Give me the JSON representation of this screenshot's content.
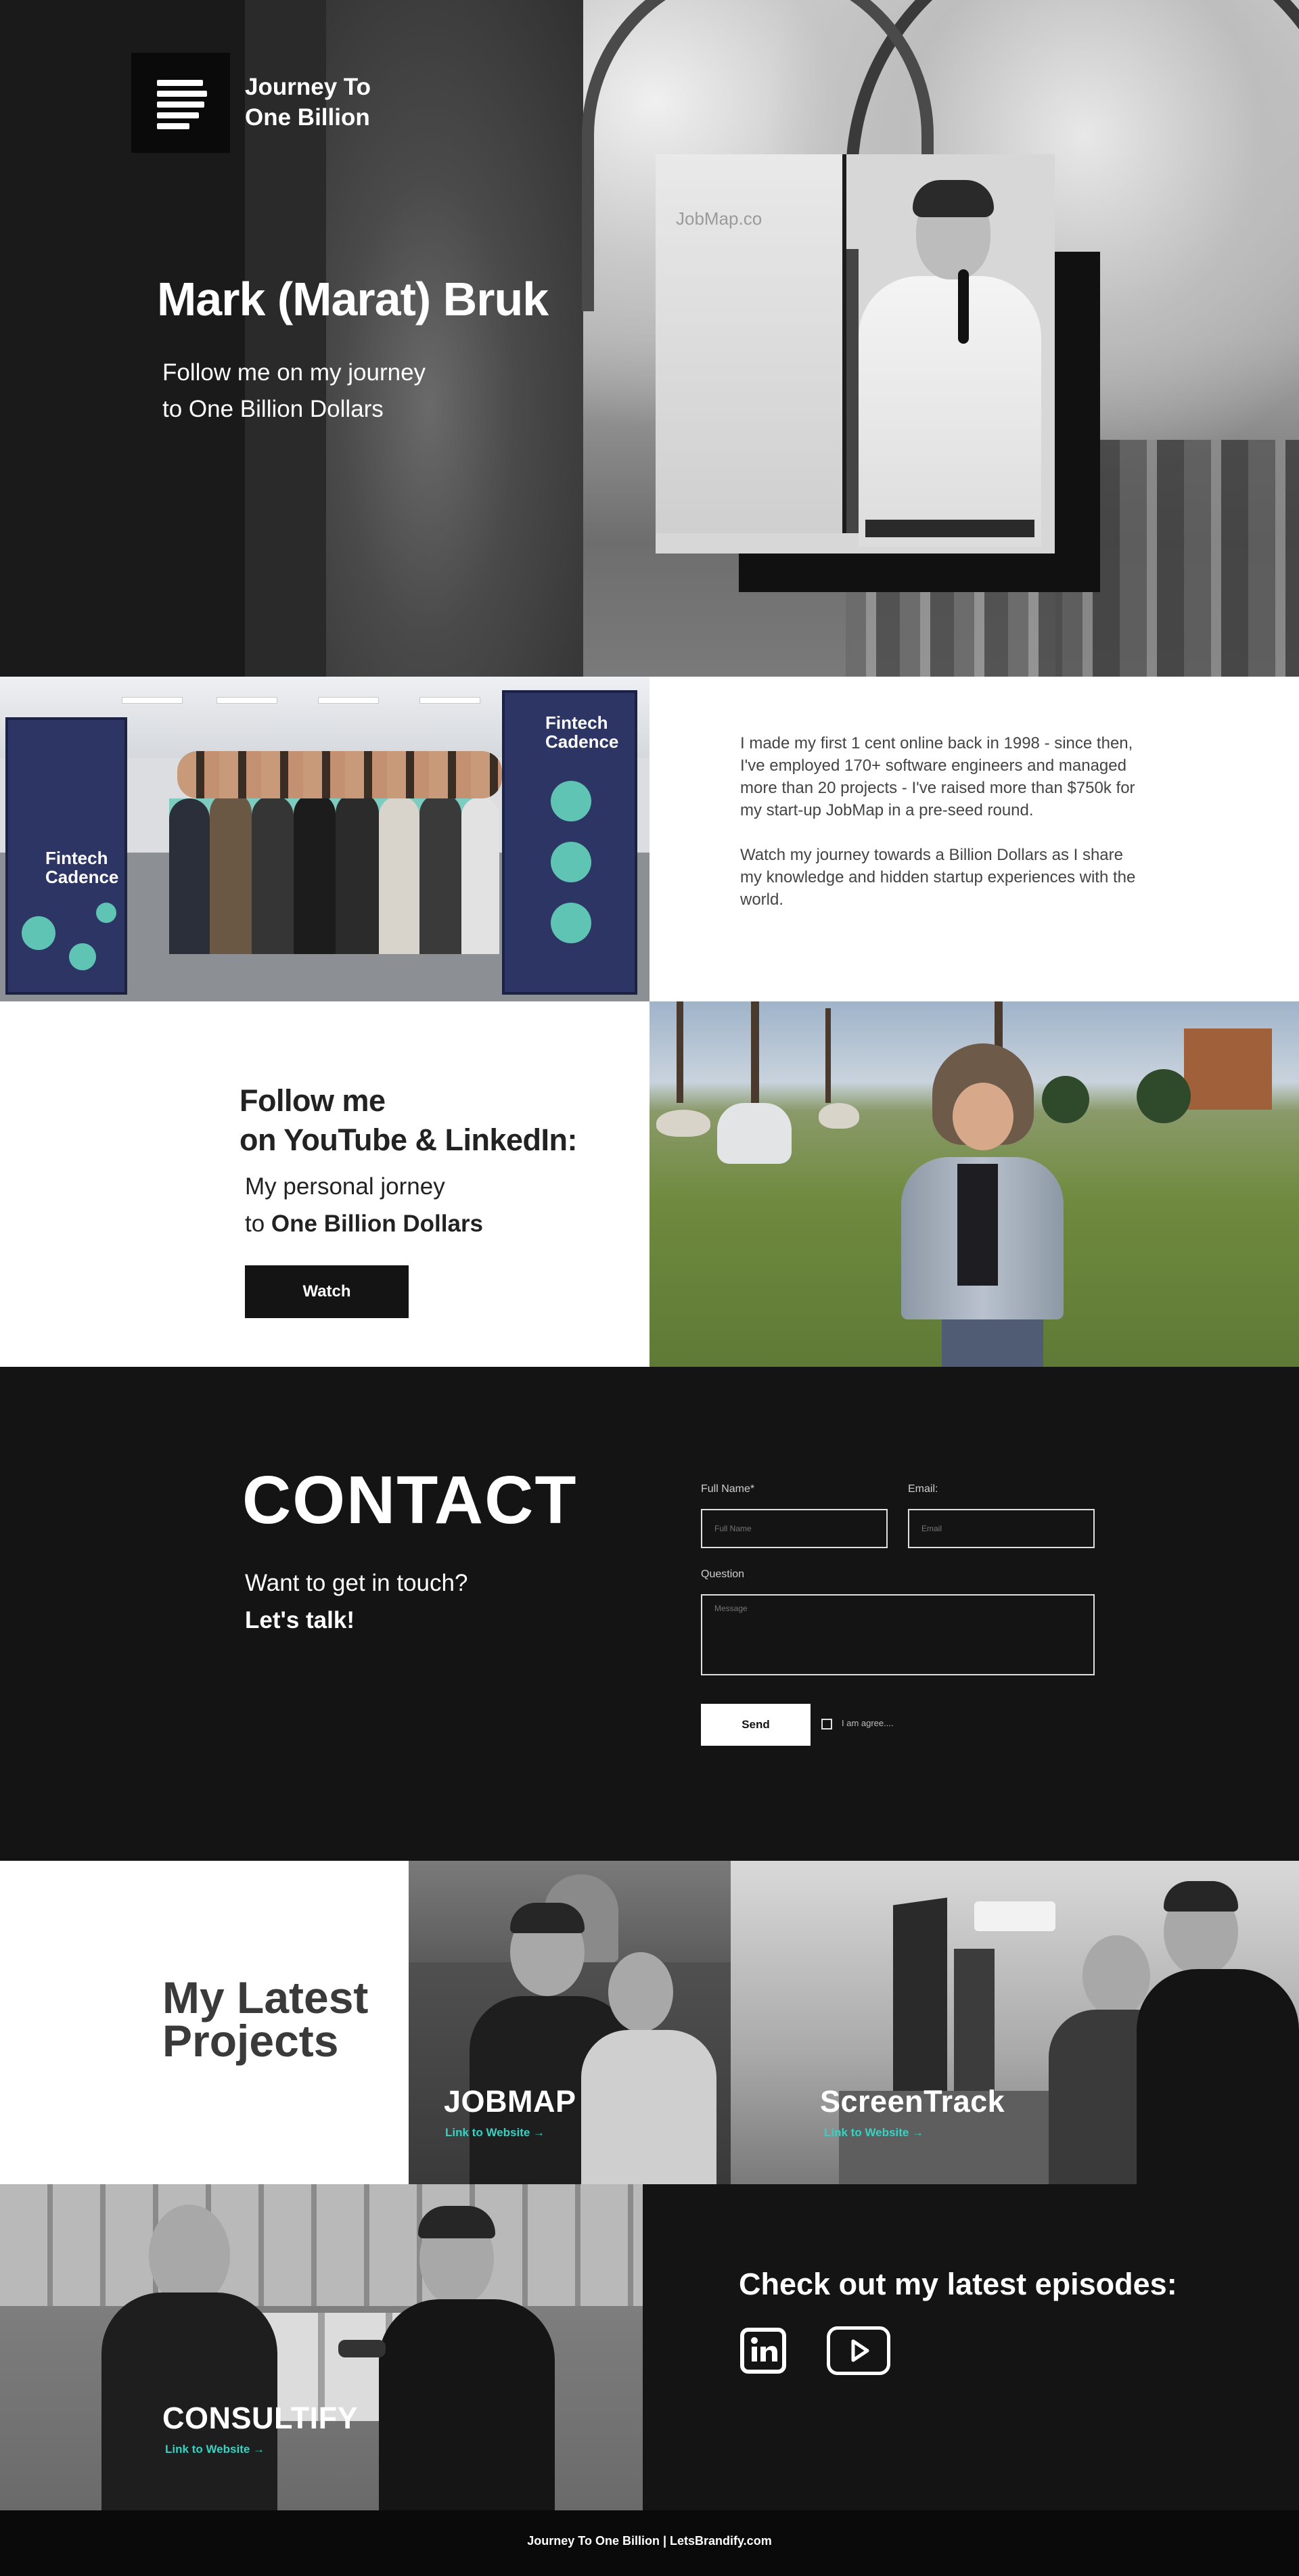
{
  "brand": {
    "logo_line1": "Journey To",
    "logo_line2": "One Billion",
    "logo_icon": "menu-lines-icon"
  },
  "hero": {
    "name": "Mark (Marat) Bruk",
    "subtitle_line1": "Follow me on my journey",
    "subtitle_line2": "to One Billion Dollars",
    "screen_text": "JobMap.co"
  },
  "about": {
    "paragraph1": "I made my first 1 cent online back in 1998 - since then, I've employed 170+ software engineers and managed more than 20 projects - I've raised more than $750k for my start-up JobMap in a pre-seed round.",
    "paragraph2": "Watch my journey towards a Billion Dollars as I share my knowledge and hidden startup experiences with the world.",
    "banner_left_title_1": "Fintech",
    "banner_left_title_2": "Cadence",
    "banner_right_title_1": "Fintech",
    "banner_right_title_2": "Cadence"
  },
  "follow": {
    "title_line1": "Follow me",
    "title_line2": "on YouTube & LinkedIn:",
    "sub_line1": "My personal jorney",
    "sub_line2_prefix": "to ",
    "sub_line2_bold": "One Billion Dollars",
    "watch_label": "Watch"
  },
  "contact": {
    "title": "CONTACT",
    "sub_line1": "Want to get in touch?",
    "sub_line2": "Let's talk!",
    "fullname_label": "Full Name*",
    "fullname_placeholder": "Full Name",
    "email_label": "Email:",
    "email_placeholder": "Email",
    "question_label": "Question",
    "message_placeholder": "Message",
    "send_label": "Send",
    "agree_label": "I am agree...."
  },
  "projects": {
    "title_line1": "My Latest",
    "title_line2": "Projects",
    "items": [
      {
        "name": "JOBMAP",
        "link": "Link to Website"
      },
      {
        "name": "ScreenTrack",
        "link": "Link to Website"
      },
      {
        "name": "CONSULTIFY",
        "link": "Link to Website"
      }
    ],
    "arrow_icon": "arrow-right-icon"
  },
  "episodes": {
    "title": "Check out my latest episodes:",
    "icons": [
      "linkedin-icon",
      "youtube-icon"
    ]
  },
  "footer": {
    "text": "Journey To One Billion | LetsBrandify.com"
  },
  "colors": {
    "dark": "#141414",
    "accent": "#38d1c2",
    "white": "#ffffff"
  }
}
